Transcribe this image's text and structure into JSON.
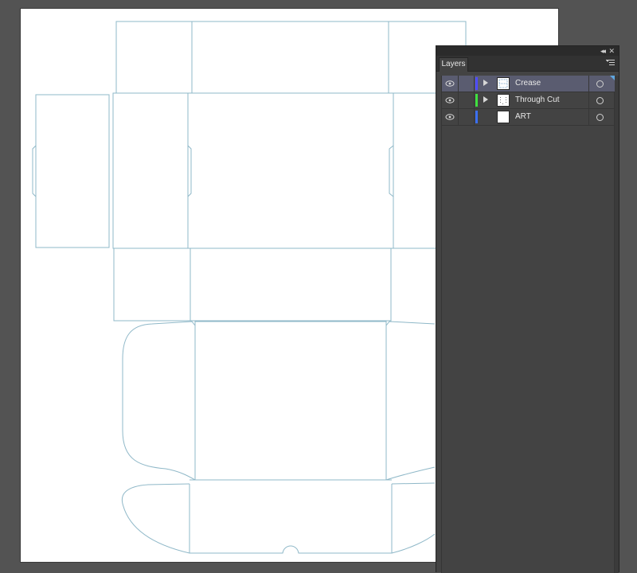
{
  "panel": {
    "tab_label": "Layers",
    "titlebar_icons": [
      "collapse-icon",
      "close-icon"
    ],
    "menu_icon": "panel-menu-icon"
  },
  "layers": [
    {
      "name": "Crease",
      "color": "#4e4cff",
      "visible": true,
      "has_sublayers": true,
      "selected": true,
      "thumb": "dashed-lines"
    },
    {
      "name": "Through Cut",
      "color": "#3fe03f",
      "visible": true,
      "has_sublayers": true,
      "selected": false,
      "thumb": "dotted-lines"
    },
    {
      "name": "ART",
      "color": "#3b6ff0",
      "visible": true,
      "has_sublayers": false,
      "selected": false,
      "thumb": "blank"
    }
  ],
  "colors": {
    "dieline": "#8fb8c8",
    "artboard": "#ffffff",
    "pasteboard": "#535353",
    "panel": "#434343",
    "selected_row": "#5a5c70"
  }
}
